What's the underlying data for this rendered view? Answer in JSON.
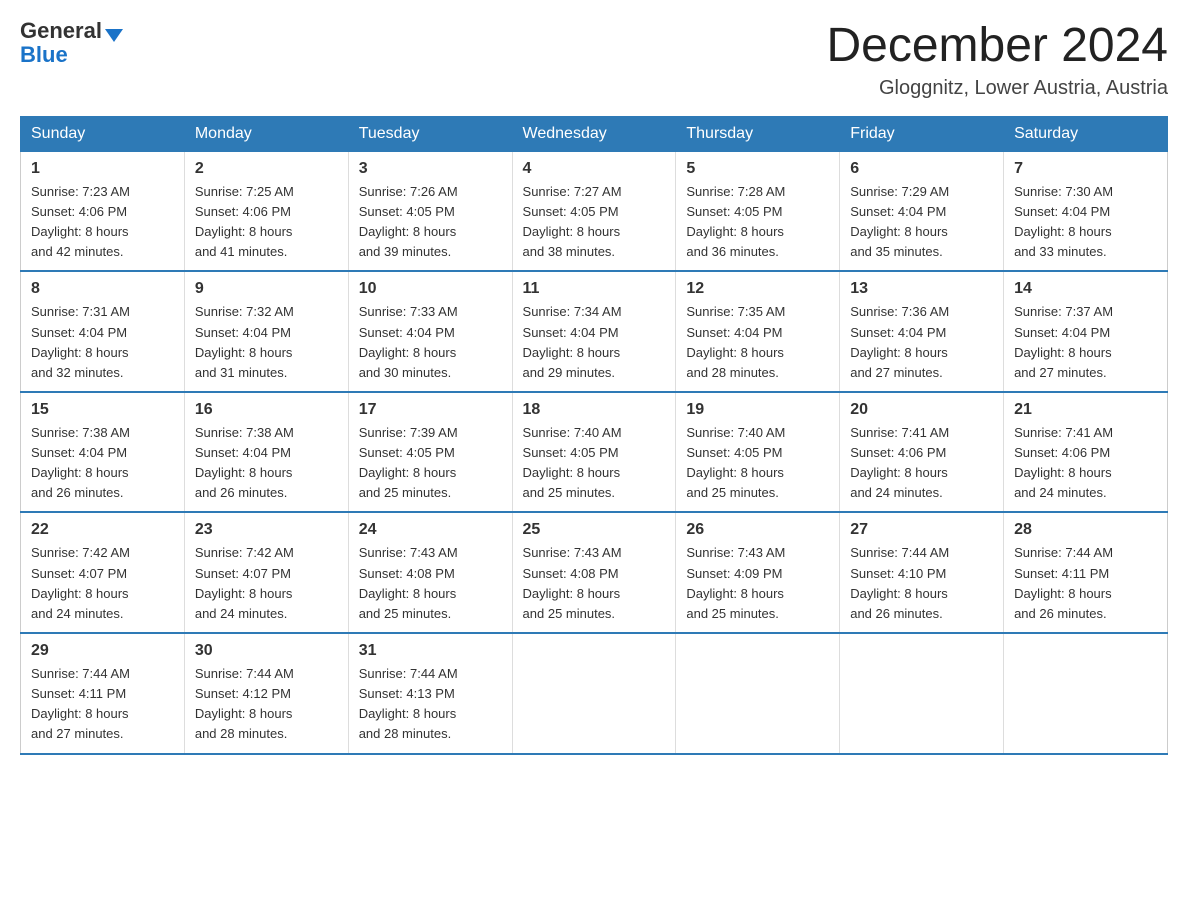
{
  "logo": {
    "general": "General",
    "blue": "Blue",
    "triangle": "▲"
  },
  "header": {
    "month_year": "December 2024",
    "location": "Gloggnitz, Lower Austria, Austria"
  },
  "weekdays": [
    "Sunday",
    "Monday",
    "Tuesday",
    "Wednesday",
    "Thursday",
    "Friday",
    "Saturday"
  ],
  "weeks": [
    [
      {
        "day": "1",
        "sunrise": "7:23 AM",
        "sunset": "4:06 PM",
        "daylight": "8 hours and 42 minutes."
      },
      {
        "day": "2",
        "sunrise": "7:25 AM",
        "sunset": "4:06 PM",
        "daylight": "8 hours and 41 minutes."
      },
      {
        "day": "3",
        "sunrise": "7:26 AM",
        "sunset": "4:05 PM",
        "daylight": "8 hours and 39 minutes."
      },
      {
        "day": "4",
        "sunrise": "7:27 AM",
        "sunset": "4:05 PM",
        "daylight": "8 hours and 38 minutes."
      },
      {
        "day": "5",
        "sunrise": "7:28 AM",
        "sunset": "4:05 PM",
        "daylight": "8 hours and 36 minutes."
      },
      {
        "day": "6",
        "sunrise": "7:29 AM",
        "sunset": "4:04 PM",
        "daylight": "8 hours and 35 minutes."
      },
      {
        "day": "7",
        "sunrise": "7:30 AM",
        "sunset": "4:04 PM",
        "daylight": "8 hours and 33 minutes."
      }
    ],
    [
      {
        "day": "8",
        "sunrise": "7:31 AM",
        "sunset": "4:04 PM",
        "daylight": "8 hours and 32 minutes."
      },
      {
        "day": "9",
        "sunrise": "7:32 AM",
        "sunset": "4:04 PM",
        "daylight": "8 hours and 31 minutes."
      },
      {
        "day": "10",
        "sunrise": "7:33 AM",
        "sunset": "4:04 PM",
        "daylight": "8 hours and 30 minutes."
      },
      {
        "day": "11",
        "sunrise": "7:34 AM",
        "sunset": "4:04 PM",
        "daylight": "8 hours and 29 minutes."
      },
      {
        "day": "12",
        "sunrise": "7:35 AM",
        "sunset": "4:04 PM",
        "daylight": "8 hours and 28 minutes."
      },
      {
        "day": "13",
        "sunrise": "7:36 AM",
        "sunset": "4:04 PM",
        "daylight": "8 hours and 27 minutes."
      },
      {
        "day": "14",
        "sunrise": "7:37 AM",
        "sunset": "4:04 PM",
        "daylight": "8 hours and 27 minutes."
      }
    ],
    [
      {
        "day": "15",
        "sunrise": "7:38 AM",
        "sunset": "4:04 PM",
        "daylight": "8 hours and 26 minutes."
      },
      {
        "day": "16",
        "sunrise": "7:38 AM",
        "sunset": "4:04 PM",
        "daylight": "8 hours and 26 minutes."
      },
      {
        "day": "17",
        "sunrise": "7:39 AM",
        "sunset": "4:05 PM",
        "daylight": "8 hours and 25 minutes."
      },
      {
        "day": "18",
        "sunrise": "7:40 AM",
        "sunset": "4:05 PM",
        "daylight": "8 hours and 25 minutes."
      },
      {
        "day": "19",
        "sunrise": "7:40 AM",
        "sunset": "4:05 PM",
        "daylight": "8 hours and 25 minutes."
      },
      {
        "day": "20",
        "sunrise": "7:41 AM",
        "sunset": "4:06 PM",
        "daylight": "8 hours and 24 minutes."
      },
      {
        "day": "21",
        "sunrise": "7:41 AM",
        "sunset": "4:06 PM",
        "daylight": "8 hours and 24 minutes."
      }
    ],
    [
      {
        "day": "22",
        "sunrise": "7:42 AM",
        "sunset": "4:07 PM",
        "daylight": "8 hours and 24 minutes."
      },
      {
        "day": "23",
        "sunrise": "7:42 AM",
        "sunset": "4:07 PM",
        "daylight": "8 hours and 24 minutes."
      },
      {
        "day": "24",
        "sunrise": "7:43 AM",
        "sunset": "4:08 PM",
        "daylight": "8 hours and 25 minutes."
      },
      {
        "day": "25",
        "sunrise": "7:43 AM",
        "sunset": "4:08 PM",
        "daylight": "8 hours and 25 minutes."
      },
      {
        "day": "26",
        "sunrise": "7:43 AM",
        "sunset": "4:09 PM",
        "daylight": "8 hours and 25 minutes."
      },
      {
        "day": "27",
        "sunrise": "7:44 AM",
        "sunset": "4:10 PM",
        "daylight": "8 hours and 26 minutes."
      },
      {
        "day": "28",
        "sunrise": "7:44 AM",
        "sunset": "4:11 PM",
        "daylight": "8 hours and 26 minutes."
      }
    ],
    [
      {
        "day": "29",
        "sunrise": "7:44 AM",
        "sunset": "4:11 PM",
        "daylight": "8 hours and 27 minutes."
      },
      {
        "day": "30",
        "sunrise": "7:44 AM",
        "sunset": "4:12 PM",
        "daylight": "8 hours and 28 minutes."
      },
      {
        "day": "31",
        "sunrise": "7:44 AM",
        "sunset": "4:13 PM",
        "daylight": "8 hours and 28 minutes."
      },
      null,
      null,
      null,
      null
    ]
  ],
  "labels": {
    "sunrise": "Sunrise: ",
    "sunset": "Sunset: ",
    "daylight": "Daylight: "
  }
}
